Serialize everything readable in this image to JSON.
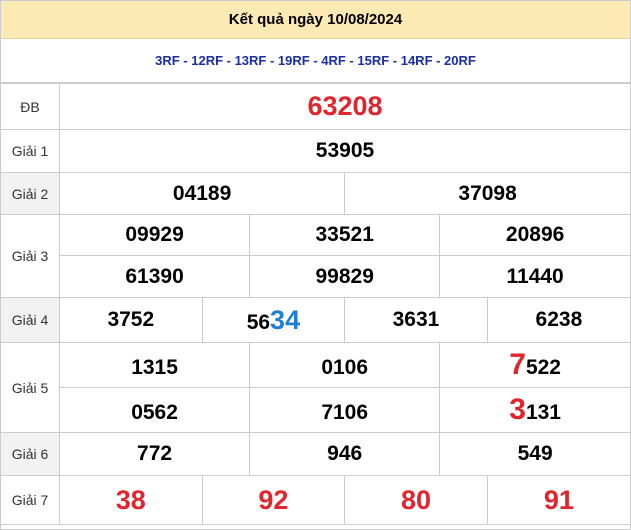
{
  "header": {
    "title": "Kết quả ngày 10/08/2024"
  },
  "codes": "3RF - 12RF - 13RF - 19RF - 4RF - 15RF - 14RF - 20RF",
  "labels": {
    "db": "ĐB",
    "g1": "Giải 1",
    "g2": "Giải 2",
    "g3": "Giải 3",
    "g4": "Giải 4",
    "g5": "Giải 5",
    "g6": "Giải 6",
    "g7": "Giải 7"
  },
  "db": "63208",
  "g1": "53905",
  "g2": [
    "04189",
    "37098"
  ],
  "g3": [
    "09929",
    "33521",
    "20896",
    "61390",
    "99829",
    "11440"
  ],
  "g4": [
    {
      "prefix": "",
      "suffix": "3752"
    },
    {
      "prefix": "56",
      "suffix": "34"
    },
    {
      "prefix": "",
      "suffix": "3631"
    },
    {
      "prefix": "",
      "suffix": "6238"
    }
  ],
  "g5": [
    {
      "head": "",
      "tail": "1315"
    },
    {
      "head": "",
      "tail": "0106"
    },
    {
      "head": "7",
      "tail": "522"
    },
    {
      "head": "",
      "tail": "0562"
    },
    {
      "head": "",
      "tail": "7106"
    },
    {
      "head": "3",
      "tail": "131"
    }
  ],
  "g6": [
    "772",
    "946",
    "549"
  ],
  "g7": [
    "38",
    "92",
    "80",
    "91"
  ],
  "colors": {
    "header_bg": "#fce9b4",
    "code_text": "#1a2ea6",
    "red": "#e1252d",
    "blue": "#1e7fd6",
    "alt_row": "#f2f2f2"
  }
}
